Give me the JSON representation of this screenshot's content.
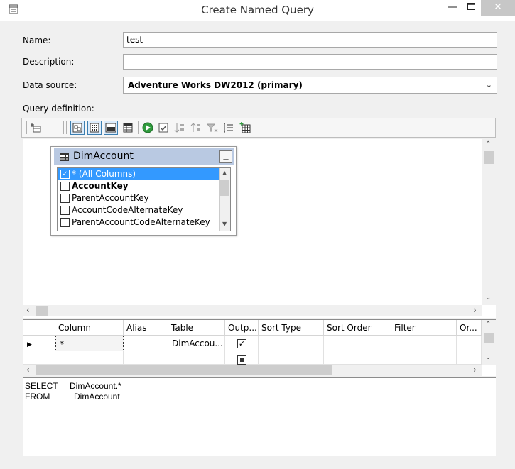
{
  "window": {
    "title": "Create Named Query",
    "minimize_glyph": "—",
    "maximize_glyph": "☐",
    "close_glyph": "✕"
  },
  "form": {
    "name_label": "Name:",
    "name_value": "test",
    "description_label": "Description:",
    "description_value": "",
    "datasource_label": "Data source:",
    "datasource_value": "Adventure Works DW2012 (primary)",
    "query_label": "Query definition:"
  },
  "toolbar": {
    "icons": [
      "add-table-icon",
      "diagram-pane-icon",
      "grid-pane-icon",
      "sql-pane-icon",
      "results-pane-icon",
      "run-icon",
      "verify-sql-icon",
      "sort-ascending-icon",
      "sort-descending-icon",
      "filter-icon",
      "group-by-icon",
      "add-table-icon-2"
    ]
  },
  "diagram": {
    "table_name": "DimAccount",
    "columns": [
      {
        "label": "* (All Columns)",
        "checked": true,
        "bold": false,
        "selected": true
      },
      {
        "label": "AccountKey",
        "checked": false,
        "bold": true,
        "selected": false
      },
      {
        "label": "ParentAccountKey",
        "checked": false,
        "bold": false,
        "selected": false
      },
      {
        "label": "AccountCodeAlternateKey",
        "checked": false,
        "bold": false,
        "selected": false
      },
      {
        "label": "ParentAccountCodeAlternateKey",
        "checked": false,
        "bold": false,
        "selected": false
      }
    ]
  },
  "grid": {
    "headers": [
      "Column",
      "Alias",
      "Table",
      "Outp...",
      "Sort Type",
      "Sort Order",
      "Filter",
      "Or..."
    ],
    "rows": [
      {
        "column": "*",
        "alias": "",
        "table": "DimAccou...",
        "output": true
      }
    ]
  },
  "sql": {
    "line1_keyword": "SELECT",
    "line1_value": "DimAccount.*",
    "line2_keyword": "FROM",
    "line2_value": "DimAccount"
  },
  "colors": {
    "accent": "#3399ff",
    "table_header": "#b9c9e2",
    "close_button": "#c7c7c7"
  }
}
